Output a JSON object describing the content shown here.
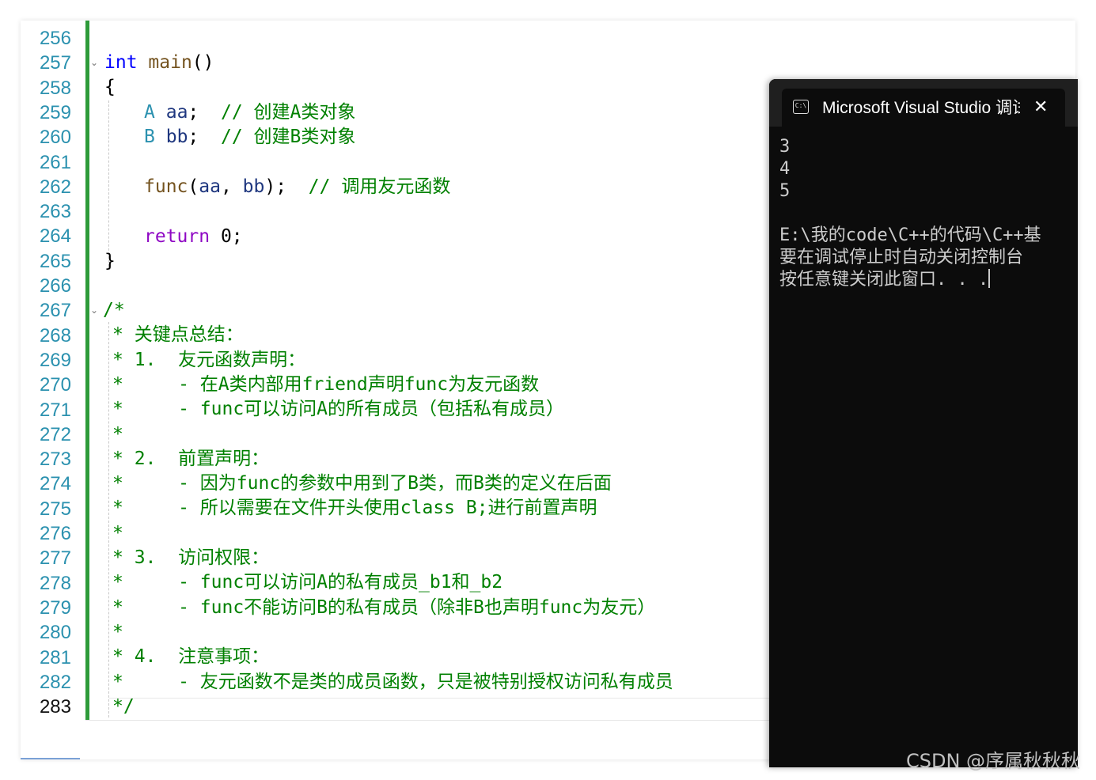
{
  "editor": {
    "line_numbers": [
      "256",
      "257",
      "258",
      "259",
      "260",
      "261",
      "262",
      "263",
      "264",
      "265",
      "266",
      "267",
      "268",
      "269",
      "270",
      "271",
      "272",
      "273",
      "274",
      "275",
      "276",
      "277",
      "278",
      "279",
      "280",
      "281",
      "282",
      "283"
    ],
    "current_line": "283",
    "code": {
      "main_kw": "int",
      "main_name": "main",
      "main_parens": "()",
      "open_brace": "{",
      "l259_type": "A",
      "l259_var": "aa",
      "l259_semi": ";",
      "l259_comment": "// 创建A类对象",
      "l260_type": "B",
      "l260_var": "bb",
      "l260_semi": ";",
      "l260_comment": "// 创建B类对象",
      "l262_fn": "func",
      "l262_open": "(",
      "l262_a": "aa",
      "l262_comma": ",",
      "l262_b": "bb",
      "l262_close": ");",
      "l262_comment": "// 调用友元函数",
      "l264_kw": "return",
      "l264_rest": "0;",
      "close_brace": "}",
      "comment_lines": [
        "/*",
        "* 关键点总结：",
        "* 1.  友元函数声明：",
        "*     - 在A类内部用friend声明func为友元函数",
        "*     - func可以访问A的所有成员（包括私有成员）",
        "*",
        "* 2.  前置声明：",
        "*     - 因为func的参数中用到了B类，而B类的定义在后面",
        "*     - 所以需要在文件开头使用class B;进行前置声明",
        "*",
        "* 3.  访问权限：",
        "*     - func可以访问A的私有成员_b1和_b2",
        "*     - func不能访问B的私有成员（除非B也声明func为友元）",
        "*",
        "* 4.  注意事项：",
        "*     - 友元函数不是类的成员函数，只是被特别授权访问私有成员",
        "*/"
      ]
    }
  },
  "console": {
    "title": "Microsoft Visual Studio 调试控制台",
    "close_glyph": "✕",
    "icon_text": "C:\\",
    "output_lines": [
      "3",
      "4",
      "5",
      "",
      "E:\\我的code\\C++的代码\\C++基",
      "要在调试停止时自动关闭控制台",
      "按任意键关闭此窗口. . ."
    ]
  },
  "watermark": "CSDN @序属秋秋秋",
  "colors": {
    "keyword": "#0000ff",
    "comment": "#008000",
    "function": "#74531f",
    "line_number": "#2b91af",
    "change_bar": "#2e9b3a",
    "console_bg": "#0c0c0c"
  }
}
